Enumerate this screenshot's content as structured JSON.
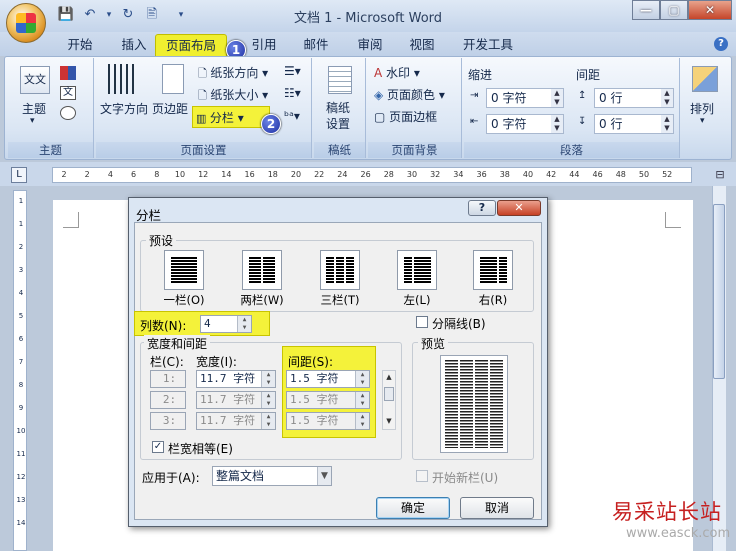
{
  "window": {
    "title": "文档 1 - Microsoft Word",
    "controls": [
      "—",
      "▢",
      "✕"
    ]
  },
  "qat": [
    "💾",
    "↶",
    "▾",
    "↻",
    "🖹",
    "▾"
  ],
  "tabs": [
    "开始",
    "插入",
    "页面布局",
    "引用",
    "邮件",
    "审阅",
    "视图",
    "开发工具"
  ],
  "callouts": [
    "1",
    "2"
  ],
  "ribbon": {
    "theme_group": {
      "label": "主题",
      "theme_btn": "主题",
      "theme_icon_text": "文文",
      "font_icon_text": "文"
    },
    "page_setup": {
      "label": "页面设置",
      "text_direction": "文字方向",
      "margins": "页边距",
      "orientation": "纸张方向",
      "size": "纸张大小",
      "columns": "分栏"
    },
    "draft": {
      "label": "稿纸",
      "btn": "稿纸\n设置"
    },
    "page_bg": {
      "label": "页面背景",
      "watermark": "水印",
      "page_color": "页面颜色",
      "page_border": "页面边框"
    },
    "paragraph": {
      "label": "段落",
      "indent": "缩进",
      "spacing": "间距",
      "indent_left": "0 字符",
      "indent_right": "0 字符",
      "space_before": "0 行",
      "space_after": "0 行"
    },
    "arrange": {
      "label": "排列"
    }
  },
  "ruler": [
    "2",
    "2",
    "4",
    "6",
    "8",
    "10",
    "12",
    "14",
    "16",
    "18",
    "20",
    "22",
    "24",
    "26",
    "28",
    "30",
    "32",
    "34",
    "36",
    "38",
    "40",
    "42",
    "44",
    "46",
    "48",
    "50",
    "52"
  ],
  "vruler": [
    "1",
    "1",
    "2",
    "3",
    "4",
    "5",
    "6",
    "7",
    "8",
    "9",
    "10",
    "11",
    "12",
    "13",
    "14"
  ],
  "dialog": {
    "title": "分栏",
    "help": "?",
    "close": "✕",
    "presets_legend": "预设",
    "presets": [
      "一栏(O)",
      "两栏(W)",
      "三栏(T)",
      "左(L)",
      "右(R)"
    ],
    "num_cols_label": "列数(N):",
    "num_cols_value": "4",
    "separator_label": "分隔线(B)",
    "width_spacing_legend": "宽度和间距",
    "col_header": "栏(C):",
    "width_header": "宽度(I):",
    "spacing_header": "间距(S):",
    "rows": [
      {
        "col": "1:",
        "width": "11.7 字符",
        "spacing": "1.5 字符"
      },
      {
        "col": "2:",
        "width": "11.7 字符",
        "spacing": "1.5 字符"
      },
      {
        "col": "3:",
        "width": "11.7 字符",
        "spacing": "1.5 字符"
      }
    ],
    "equal_width_label": "栏宽相等(E)",
    "equal_width_checked": "✓",
    "preview_legend": "预览",
    "apply_to_label": "应用于(A):",
    "apply_to_value": "整篇文档",
    "new_column_label": "开始新栏(U)",
    "ok": "确定",
    "cancel": "取消"
  },
  "watermark": {
    "text": "易采站长站",
    "url": "www.easck.com"
  },
  "colors": {
    "highlight": "#f4f23a",
    "callout": "#1d2fa2",
    "watermark": "#c62020"
  }
}
